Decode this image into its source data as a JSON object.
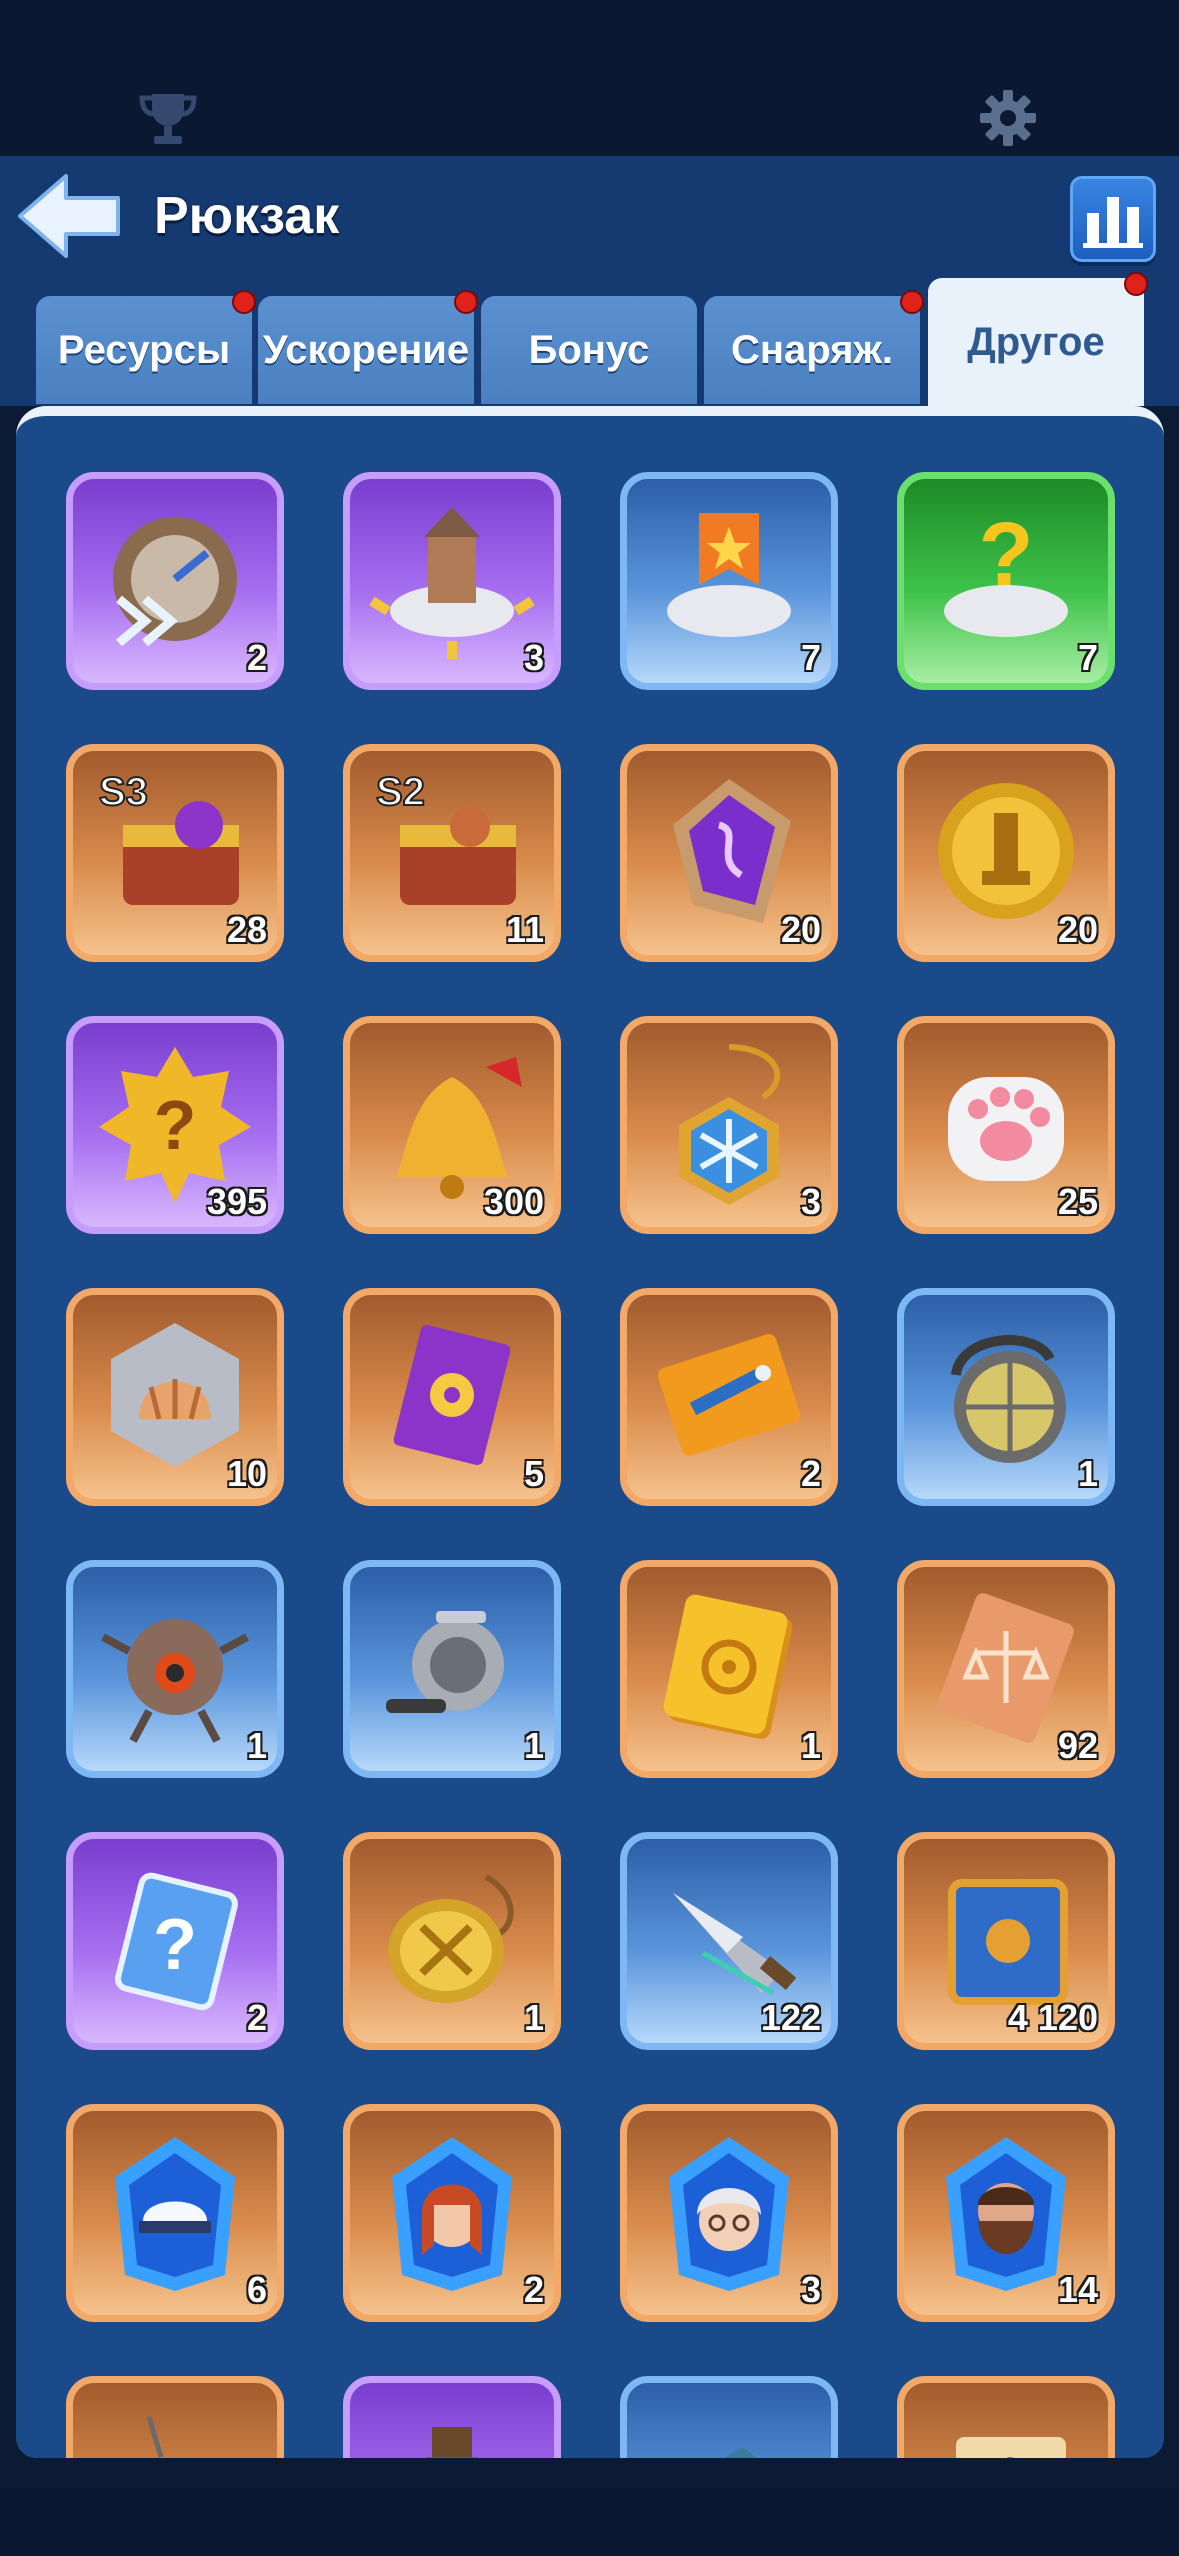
{
  "header": {
    "title": "Рюкзак"
  },
  "tabs": [
    {
      "label": "Ресурсы",
      "badge": true
    },
    {
      "label": "Ускорение",
      "badge": true
    },
    {
      "label": "Бонус",
      "badge": false
    },
    {
      "label": "Снаряж.",
      "badge": true
    },
    {
      "label": "Другое",
      "badge": true,
      "active": true
    }
  ],
  "items": [
    {
      "icon": "speed-dial-icon",
      "frame": "purple",
      "count": "2"
    },
    {
      "icon": "building-relocate-icon",
      "frame": "purple",
      "count": "3"
    },
    {
      "icon": "banner-relocate-icon",
      "frame": "blue",
      "count": "7"
    },
    {
      "icon": "random-relocate-icon",
      "frame": "green",
      "count": "7"
    },
    {
      "icon": "s3-treasure-chest-icon",
      "frame": "orange",
      "count": "28"
    },
    {
      "icon": "s2-treasure-chest-icon",
      "frame": "orange",
      "count": "11"
    },
    {
      "icon": "purple-rune-stone-icon",
      "frame": "orange",
      "count": "20"
    },
    {
      "icon": "gold-chess-coin-icon",
      "frame": "orange",
      "count": "20"
    },
    {
      "icon": "mystery-badge-icon",
      "frame": "purple",
      "count": "395"
    },
    {
      "icon": "golden-bell-icon",
      "frame": "orange",
      "count": "300"
    },
    {
      "icon": "snowflake-amulet-icon",
      "frame": "orange",
      "count": "3"
    },
    {
      "icon": "paw-cushion-icon",
      "frame": "orange",
      "count": "25"
    },
    {
      "icon": "shell-token-icon",
      "frame": "orange",
      "count": "10"
    },
    {
      "icon": "purple-card-icon",
      "frame": "orange",
      "count": "5"
    },
    {
      "icon": "fish-ticket-icon",
      "frame": "orange",
      "count": "2"
    },
    {
      "icon": "diving-helmet-icon",
      "frame": "blue",
      "count": "1"
    },
    {
      "icon": "robot-drone-icon",
      "frame": "blue",
      "count": "1"
    },
    {
      "icon": "fishing-reel-icon",
      "frame": "blue",
      "count": "1"
    },
    {
      "icon": "gold-target-ticket-icon",
      "frame": "orange",
      "count": "1"
    },
    {
      "icon": "scales-ticket-icon",
      "frame": "orange",
      "count": "92"
    },
    {
      "icon": "mystery-crystal-icon",
      "frame": "purple",
      "count": "2"
    },
    {
      "icon": "sword-medallion-icon",
      "frame": "orange",
      "count": "1"
    },
    {
      "icon": "spearhead-icon",
      "frame": "blue",
      "count": "122"
    },
    {
      "icon": "blue-tome-icon",
      "frame": "orange",
      "count": "4 120"
    },
    {
      "icon": "captain-hat-shard-icon",
      "frame": "orange",
      "count": "6"
    },
    {
      "icon": "hero-redhair-shard-icon",
      "frame": "orange",
      "count": "2"
    },
    {
      "icon": "hero-oldlady-shard-icon",
      "frame": "orange",
      "count": "3"
    },
    {
      "icon": "hero-bearded-shard-icon",
      "frame": "orange",
      "count": "14"
    },
    {
      "icon": "syringe-icon",
      "frame": "orange",
      "count": ""
    },
    {
      "icon": "potion-bottle-icon",
      "frame": "purple",
      "count": ""
    },
    {
      "icon": "blue-box-icon",
      "frame": "blue",
      "count": ""
    },
    {
      "icon": "sun-scroll-icon",
      "frame": "orange",
      "count": ""
    }
  ]
}
